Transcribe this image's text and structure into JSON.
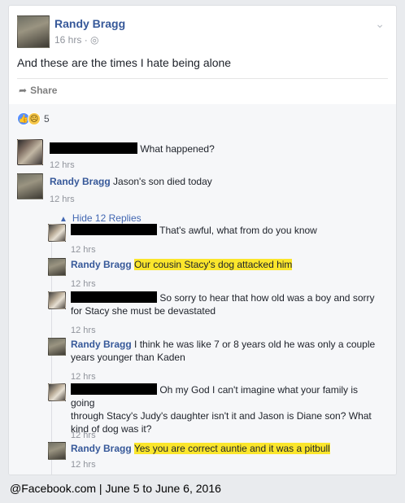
{
  "post": {
    "author": "Randy Bragg",
    "time": "16 hrs",
    "privacy_icon": "globe-icon",
    "text": "And these are the times I hate being alone",
    "share_label": "Share",
    "reaction_count": "5"
  },
  "comments": [
    {
      "name": "",
      "text": "What happened?",
      "time": "12 hrs"
    },
    {
      "name": "Randy Bragg",
      "text": "Jason's son died today",
      "time": "12 hrs"
    }
  ],
  "hide_replies_label": "Hide 12 Replies",
  "replies": [
    {
      "name": "",
      "text": "That's awful, what from do you know",
      "time": "12 hrs"
    },
    {
      "name": "Randy Bragg",
      "text": "Our cousin Stacy's dog attacked him",
      "time": "12 hrs"
    },
    {
      "name": "",
      "text_line1": "So sorry to hear that how old was a boy and sorry",
      "text_line2": "for Stacy she must be devastated",
      "time": "12 hrs"
    },
    {
      "name": "Randy Bragg",
      "text_line1": "I think he was like 7 or 8 years old he was only a couple",
      "text_line2": "years younger than Kaden",
      "time": "12 hrs"
    },
    {
      "name": "",
      "text_line1": "Oh my God I can't imagine what your family is going",
      "text_line2": "through Stacy's Judy's daughter isn't it and Jason is Diane son? What",
      "text_line3": "kind of dog was it?",
      "time": "12 hrs"
    },
    {
      "name": "Randy Bragg",
      "text": "Yes you are correct auntie and it was a pitbull",
      "time": "12 hrs"
    }
  ],
  "caption": "@Facebook.com | June 5 to June 6, 2016",
  "colors": {
    "link": "#365899",
    "highlight": "#fbe62c",
    "redaction": "#000000"
  }
}
